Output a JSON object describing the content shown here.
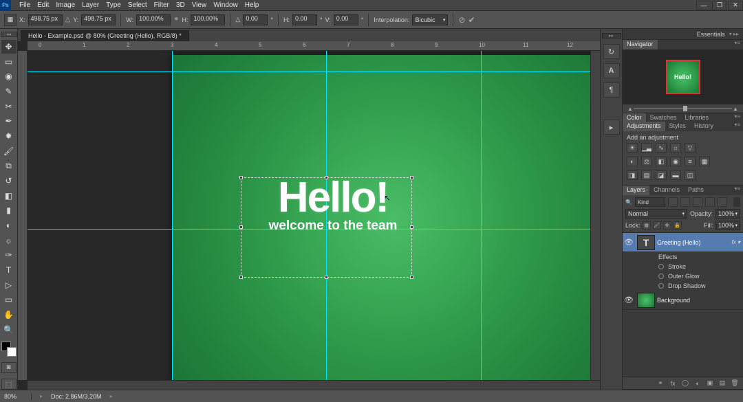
{
  "menu": [
    "File",
    "Edit",
    "Image",
    "Layer",
    "Type",
    "Select",
    "Filter",
    "3D",
    "View",
    "Window",
    "Help"
  ],
  "options": {
    "x_label": "X:",
    "x_val": "498.75 px",
    "y_label": "Y:",
    "y_val": "498.75 px",
    "w_label": "W:",
    "w_val": "100.00%",
    "h_label": "H:",
    "h_val": "100.00%",
    "angle_label": "△",
    "angle_val": "0.00",
    "angle_unit": "°",
    "skewh_label": "H:",
    "skewh_val": "0.00",
    "skewh_unit": "°",
    "skewv_label": "V:",
    "skewv_val": "0.00",
    "skewv_unit": "°",
    "interp_label": "Interpolation:",
    "interp_val": "Bicubic"
  },
  "doc_tab": "Hello - Example.psd @ 80% (Greeting (Hello), RGB/8) *",
  "ruler_h": [
    "0",
    "1",
    "2",
    "3",
    "4",
    "5",
    "6",
    "7",
    "8",
    "9",
    "10",
    "11",
    "12"
  ],
  "canvas": {
    "main_text": "Hello!",
    "sub_text": "welcome to the team",
    "preview_text": "Hello!"
  },
  "workspace": "Essentials",
  "panels": {
    "navigator_tab": "Navigator",
    "color_tabs": [
      "Color",
      "Swatches",
      "Libraries"
    ],
    "adj_tabs": [
      "Adjustments",
      "Styles",
      "History"
    ],
    "adj_title": "Add an adjustment",
    "layers_tabs": [
      "Layers",
      "Channels",
      "Paths"
    ],
    "kind_label": "Kind",
    "blend_mode": "Normal",
    "opacity_label": "Opacity:",
    "opacity_val": "100%",
    "lock_label": "Lock:",
    "fill_label": "Fill:",
    "fill_val": "100%"
  },
  "layers": {
    "text_layer": "Greeting (Hello)",
    "fx_label": "fx",
    "effects_label": "Effects",
    "effects": [
      "Stroke",
      "Outer Glow",
      "Drop Shadow"
    ],
    "bg_layer": "Background"
  },
  "status": {
    "zoom": "80%",
    "doc_info": "Doc: 2.86M/3.20M"
  }
}
